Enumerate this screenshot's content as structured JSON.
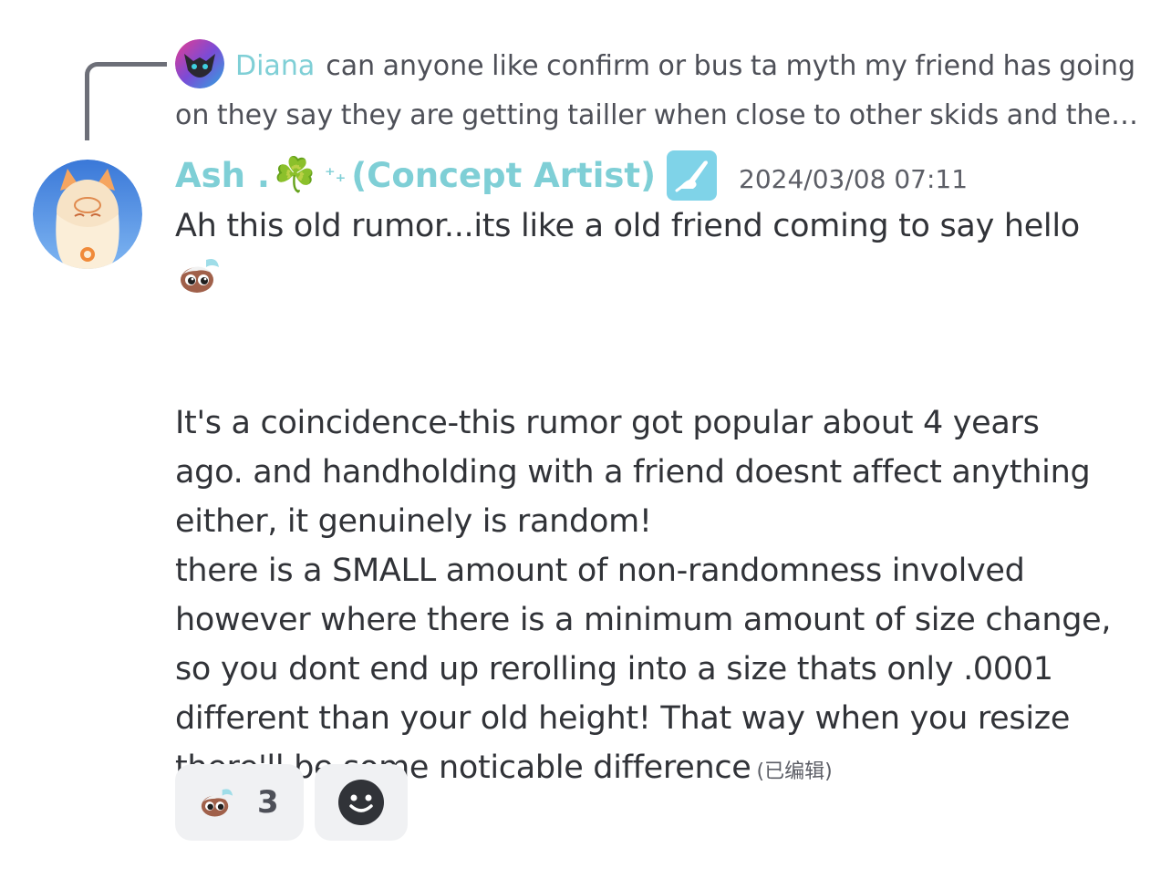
{
  "reply": {
    "author": "Diana",
    "text": "can anyone like confirm or bus ta myth my friend has going on they say they are getting tailler when close to other skids and then I was wondering if it might have something to do with handholding"
  },
  "message": {
    "author": "Ash .",
    "author_suffix": "(Concept Artist)",
    "clover_emoji": "☘️",
    "sparkle": "⁺₊",
    "timestamp": "2024/03/08 07:11",
    "lines": [
      "Ah this old rumor...its like a old friend coming to say hello",
      "It's a coincidence-this rumor got popular about 4 years",
      "ago. and handholding with a friend doesnt affect anything",
      "either, it genuinely is random!",
      "there is a SMALL amount of non-randomness involved",
      "however where there is a minimum amount of size change,",
      "so you dont end up rerolling into a size thats only .0001",
      "different than your old height! That way when you resize",
      "there'll be some noticable difference"
    ],
    "edited_label": "(已编辑)"
  },
  "reactions": [
    {
      "emoji": "crying-face-custom-emoji",
      "count": "3"
    }
  ],
  "add_reaction_icon": "smiley-add-reaction-icon",
  "colors": {
    "name_teal": "#7fcfd6",
    "text": "#313338",
    "muted": "#5c5e66",
    "reaction_bg": "#f0f1f3"
  }
}
